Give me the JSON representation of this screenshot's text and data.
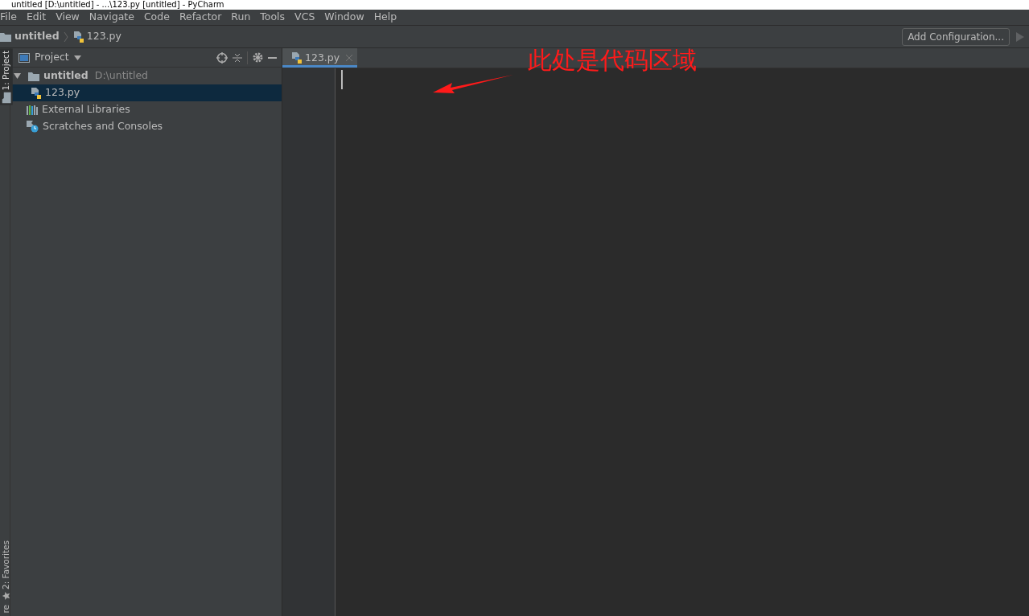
{
  "window": {
    "title": "untitled [D:\\untitled] - ...\\123.py [untitled] - PyCharm"
  },
  "menu": [
    "File",
    "Edit",
    "View",
    "Navigate",
    "Code",
    "Refactor",
    "Run",
    "Tools",
    "VCS",
    "Window",
    "Help"
  ],
  "breadcrumb": [
    {
      "label": "untitled",
      "kind": "folder"
    },
    {
      "label": "123.py",
      "kind": "python"
    }
  ],
  "run_config": {
    "label": "Add Configuration...",
    "disabled_run": true
  },
  "side_tabs_top": [
    {
      "label": "1: Project",
      "kind": "folder",
      "selected": true
    }
  ],
  "side_tabs_bottom": [
    {
      "label": "2: Favorites",
      "kind": "star",
      "selected": false
    },
    {
      "label": "re",
      "kind": "plain",
      "selected": false
    }
  ],
  "project_panel": {
    "title": "Project",
    "tree": [
      {
        "label": "untitled",
        "path": "D:\\untitled",
        "kind": "folder",
        "expanded": true,
        "selected": false,
        "children": [
          {
            "label": "123.py",
            "kind": "python",
            "selected": true
          }
        ]
      },
      {
        "label": "External Libraries",
        "kind": "library",
        "selected": false
      },
      {
        "label": "Scratches and Consoles",
        "kind": "scratch",
        "selected": false
      }
    ]
  },
  "editor": {
    "tabs": [
      {
        "label": "123.py",
        "kind": "python",
        "selected": true
      }
    ],
    "annotation": "此处是代码区域"
  }
}
